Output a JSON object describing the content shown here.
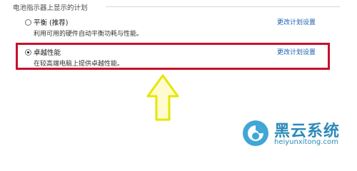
{
  "section": {
    "title": "电池指示器上显示的计划"
  },
  "plans": [
    {
      "name": "平衡 (推荐)",
      "description": "利用可用的硬件自动平衡功耗与性能。",
      "link": "更改计划设置",
      "selected": false
    },
    {
      "name": "卓越性能",
      "description": "在较高端电脑上提供卓越性能。",
      "link": "更改计划设置",
      "selected": true
    }
  ],
  "watermark": {
    "title": "黑云系统",
    "url": "heiyunxitong.com"
  },
  "colors": {
    "highlight": "#c8102e",
    "arrow_fill": "#fffbd0",
    "arrow_stroke": "#e6e600",
    "link": "#1a5fb4",
    "watermark": "#2b8ab8"
  }
}
